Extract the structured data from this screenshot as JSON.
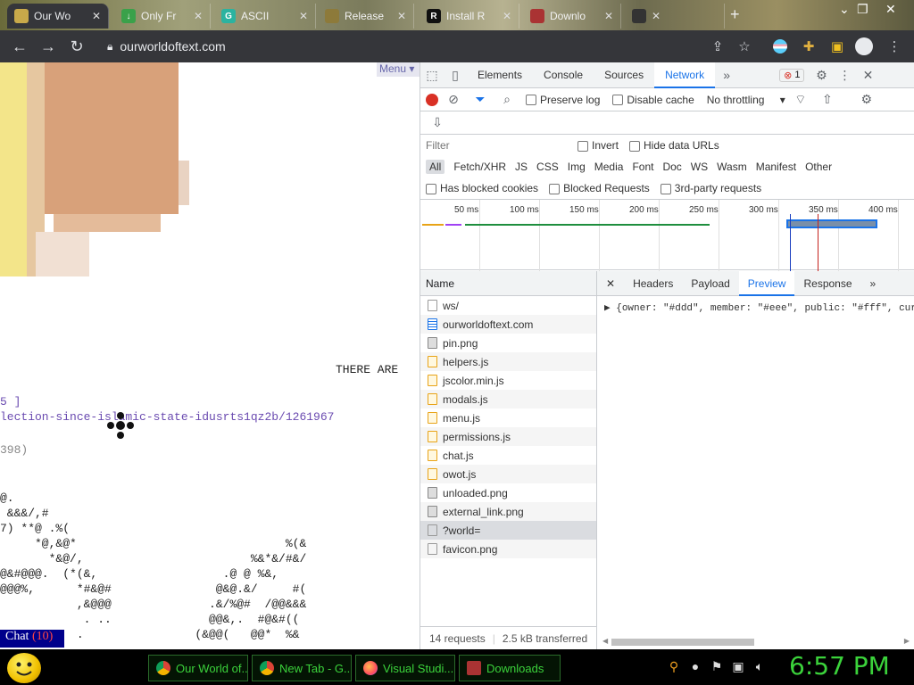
{
  "browser": {
    "tabs": [
      {
        "title": "Our Wo",
        "active": true
      },
      {
        "title": "Only Fr",
        "active": false
      },
      {
        "title": "ASCII",
        "active": false
      },
      {
        "title": "Release",
        "active": false
      },
      {
        "title": "Install R",
        "active": false
      },
      {
        "title": "Downlo",
        "active": false
      }
    ],
    "url": "ourworldoftext.com"
  },
  "page": {
    "menu_label": "Menu",
    "there_are": "THERE ARE",
    "bracket_line": "5 ]",
    "link_text": "lection-since-islamic-state-idusrts1qz2b/1261967",
    "paren_line": "398)",
    "chat_label": "Chat",
    "chat_count": "(10)"
  },
  "devtools": {
    "tabs": [
      "Elements",
      "Console",
      "Sources",
      "Network"
    ],
    "active_tab": "Network",
    "error_count": "1",
    "toolbar": {
      "preserve_log": "Preserve log",
      "disable_cache": "Disable cache",
      "throttling": "No throttling"
    },
    "filter": {
      "placeholder": "Filter",
      "invert": "Invert",
      "hide_data_urls": "Hide data URLs"
    },
    "types": [
      "All",
      "Fetch/XHR",
      "JS",
      "CSS",
      "Img",
      "Media",
      "Font",
      "Doc",
      "WS",
      "Wasm",
      "Manifest",
      "Other"
    ],
    "blocked": {
      "has_blocked_cookies": "Has blocked cookies",
      "blocked_requests": "Blocked Requests",
      "third_party": "3rd-party requests"
    },
    "timeline_labels": [
      "50 ms",
      "100 ms",
      "150 ms",
      "200 ms",
      "250 ms",
      "300 ms",
      "350 ms",
      "400 ms"
    ],
    "name_header": "Name",
    "requests": [
      {
        "name": "ws/",
        "type": "other"
      },
      {
        "name": "ourworldoftext.com",
        "type": "doc"
      },
      {
        "name": "pin.png",
        "type": "img"
      },
      {
        "name": "helpers.js",
        "type": "js"
      },
      {
        "name": "jscolor.min.js",
        "type": "js"
      },
      {
        "name": "modals.js",
        "type": "js"
      },
      {
        "name": "menu.js",
        "type": "js"
      },
      {
        "name": "permissions.js",
        "type": "js"
      },
      {
        "name": "chat.js",
        "type": "js"
      },
      {
        "name": "owot.js",
        "type": "js"
      },
      {
        "name": "unloaded.png",
        "type": "img"
      },
      {
        "name": "external_link.png",
        "type": "img"
      },
      {
        "name": "?world=",
        "type": "other",
        "selected": true
      },
      {
        "name": "favicon.png",
        "type": "other"
      }
    ],
    "status": {
      "requests": "14 requests",
      "transferred": "2.5 kB transferred"
    },
    "detail_tabs": [
      "Headers",
      "Payload",
      "Preview",
      "Response"
    ],
    "active_detail_tab": "Preview",
    "preview_text": "▶ {owner: \"#ddd\", member: \"#eee\", public: \"#fff\", cur"
  },
  "taskbar": {
    "tasks": [
      "Our World of...",
      "New Tab - G...",
      "Visual Studi...",
      "Downloads"
    ],
    "clock": "6:57 PM"
  }
}
